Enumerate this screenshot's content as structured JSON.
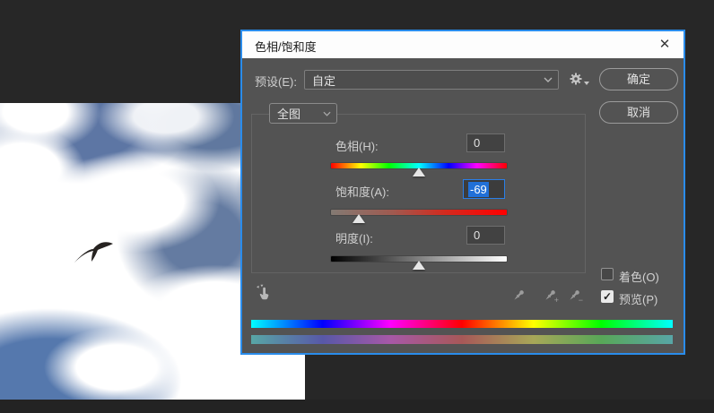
{
  "window": {
    "title": "色相/饱和度",
    "close_glyph": "✕"
  },
  "preset": {
    "label": "预设(E):",
    "value": "自定"
  },
  "buttons": {
    "ok": "确定",
    "cancel": "取消"
  },
  "channel": {
    "value": "全图"
  },
  "sliders": [
    {
      "label": "色相(H):",
      "value": "0"
    },
    {
      "label": "饱和度(A):",
      "value": "-69"
    },
    {
      "label": "明度(I):",
      "value": "0"
    }
  ],
  "options": {
    "colorize_label": "着色(O)",
    "preview_label": "预览(P)",
    "colorize_checked": false,
    "preview_checked": true
  },
  "icons": {
    "check": "✓",
    "plus": "+",
    "minus": "−"
  },
  "colors": {
    "accent_blue": "#2a8ceb",
    "selection_blue": "#2170d8",
    "dialog_bg": "#535353",
    "workspace_bg": "#272727",
    "sky_blue": "#5d76a4"
  }
}
